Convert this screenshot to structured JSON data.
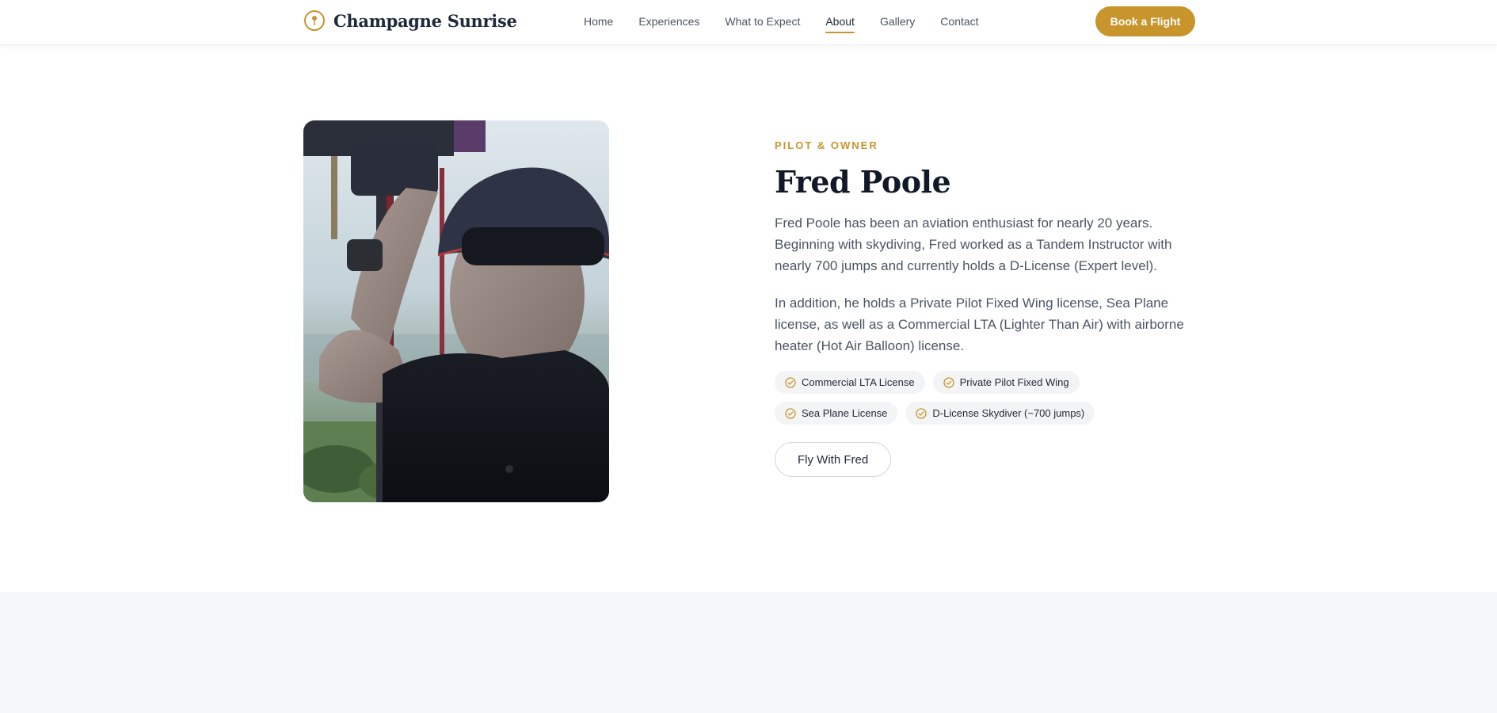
{
  "brand": {
    "name": "Champagne Sunrise",
    "accent_color": "#c8952c"
  },
  "nav": {
    "items": [
      {
        "label": "Home"
      },
      {
        "label": "Experiences"
      },
      {
        "label": "What to Expect"
      },
      {
        "label": "About",
        "active": true
      },
      {
        "label": "Gallery"
      },
      {
        "label": "Contact"
      }
    ],
    "cta_label": "Book a Flight"
  },
  "profile": {
    "photo_icon": "pilot-portrait-photo",
    "eyebrow": "PILOT & OWNER",
    "name": "Fred Poole",
    "paragraphs": [
      "Fred Poole has been an aviation enthusiast for nearly 20 years. Beginning with skydiving, Fred worked as a Tandem Instructor with nearly 700 jumps and currently holds a D-License (Expert level).",
      "In addition, he holds a Private Pilot Fixed Wing license, Sea Plane license, as well as a Commercial LTA (Lighter Than Air) with airborne heater (Hot Air Balloon) license."
    ],
    "badges": [
      {
        "label": "Commercial LTA License",
        "icon": "check-circle-icon"
      },
      {
        "label": "Private Pilot Fixed Wing",
        "icon": "check-circle-icon"
      },
      {
        "label": "Sea Plane License",
        "icon": "check-circle-icon"
      },
      {
        "label": "D-License Skydiver (~700 jumps)",
        "icon": "check-circle-icon"
      }
    ],
    "cta_label": "Fly With Fred"
  }
}
